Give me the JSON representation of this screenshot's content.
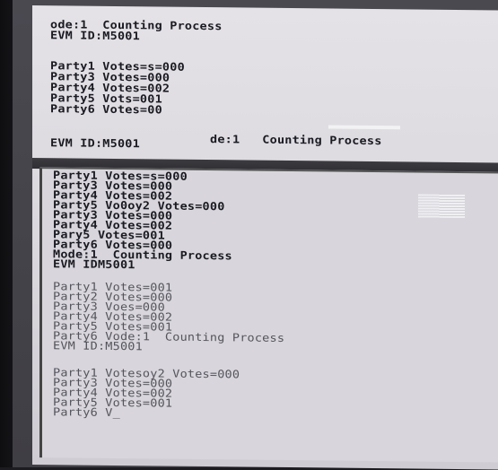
{
  "upper": [
    "ode:1  Counting Process",
    "EVM ID:M5001",
    "",
    "Party1 Votes=s=000",
    "Party3 Votes=000",
    "Party4 Votes=002",
    "Party5 Vots=001",
    "Party6 Votes=00",
    "",
    "EVM ID:M5001",
    "de:1   Counting Process"
  ],
  "lower": [
    "Party1 Votes=s=000",
    "Party3 Votes=000",
    "Party4 Votes=002",
    "Party5 Vo0oy2 Votes=000",
    "Party3 Votes=000",
    "Party4 Votes=002",
    "Pary5 Votes=001",
    "Party6 Votes=000",
    "Mode:1  Counting Process",
    "EVM IDM5001",
    "",
    "Party1 Votes=001",
    "Party2 Votes=000",
    "Party3 Voes=000",
    "Party4 Votes=002",
    "Party5 Votes=001",
    "Party6 Vode:1  Counting Process",
    "EVM ID:M5001",
    "",
    "Party1 Votesoy2 Votes=000",
    "Party3 Votes=000",
    "Party4 Votes=002",
    "Party5 Votes=001",
    "Party6 V_"
  ]
}
